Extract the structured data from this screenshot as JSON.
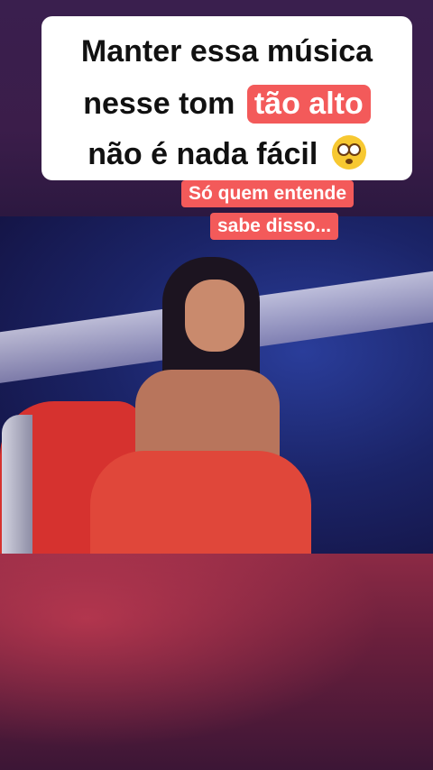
{
  "title": {
    "line1": "Manter essa música",
    "line2_prefix": "nesse tom",
    "line2_highlight": "tão alto",
    "line3": "não é nada fácil"
  },
  "subtitle": {
    "line1": "Só quem entende",
    "line2": "sabe disso..."
  },
  "emoji_name": "flushed-face-emoji",
  "colors": {
    "highlight": "#f35a5a",
    "card": "#ffffff",
    "text": "#111111"
  }
}
